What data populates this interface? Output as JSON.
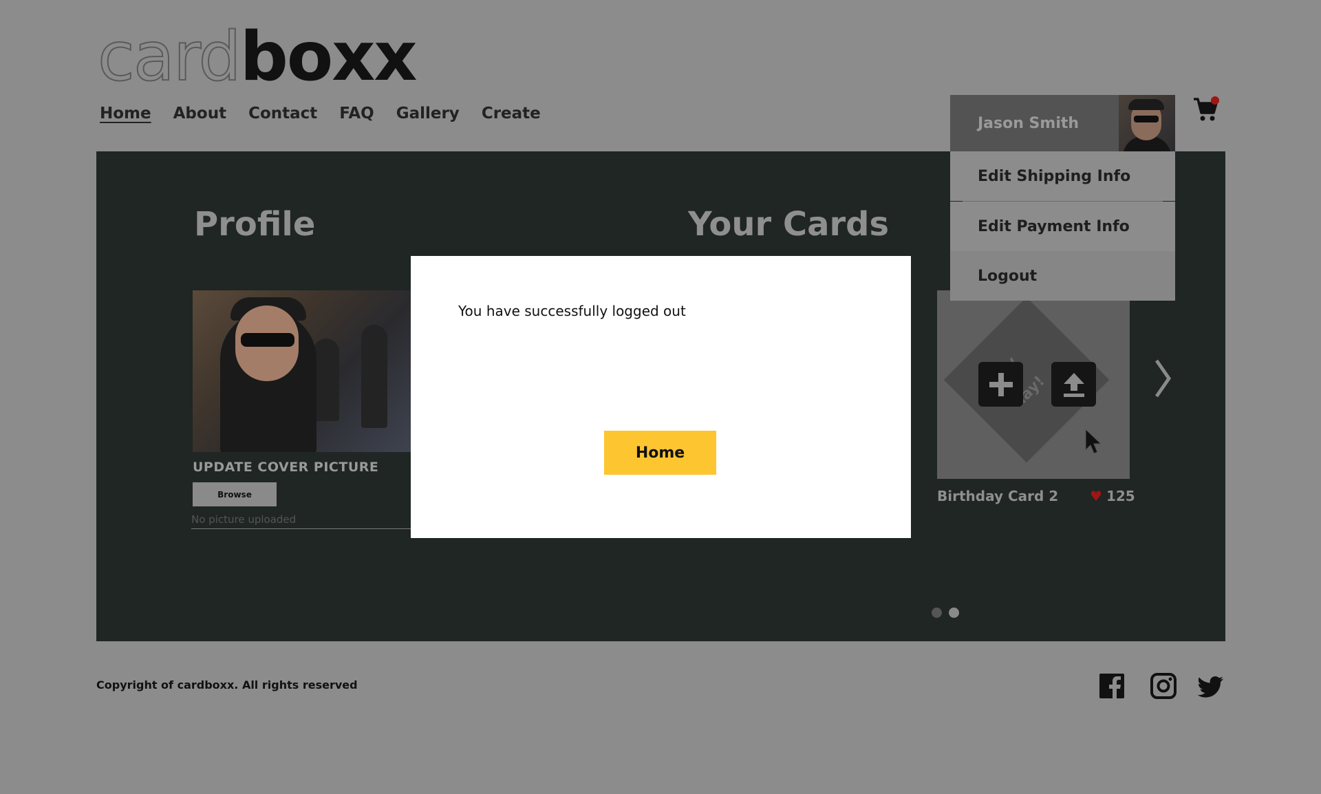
{
  "header": {
    "logo_light": "card",
    "logo_bold": "boxx",
    "nav": [
      "Home",
      "About",
      "Contact",
      "FAQ",
      "Gallery",
      "Create"
    ]
  },
  "profile": {
    "title": "Profile",
    "update_cover_label": "UPDATE COVER PICTURE",
    "browse_label": "Browse",
    "file_status": "No picture uploaded"
  },
  "cards": {
    "title": "Your Cards",
    "card_name": "Birthday Card 2",
    "likes": "125",
    "diamond_text": "ppy\nng\nday!",
    "pages": 2,
    "active_page": 2
  },
  "user_menu": {
    "name": "Jason Smith",
    "items": [
      "Edit Shipping Info",
      "Edit Payment Info",
      "Logout"
    ]
  },
  "modal": {
    "message": "You have successfully logged out",
    "button_label": "Home"
  },
  "footer": {
    "copyright": "Copyright of cardboxx. All rights reserved"
  },
  "icons": {
    "cart": "cart-icon",
    "facebook": "facebook-icon",
    "instagram": "instagram-icon",
    "twitter": "twitter-icon",
    "add": "plus-icon",
    "upload": "upload-icon",
    "next": "chevron-right-icon",
    "like": "heart-icon"
  },
  "colors": {
    "overlay_bg": "#8c8c8c",
    "panel_bg": "#1f2624",
    "accent_button": "#fdc530",
    "badge": "#a01515"
  }
}
